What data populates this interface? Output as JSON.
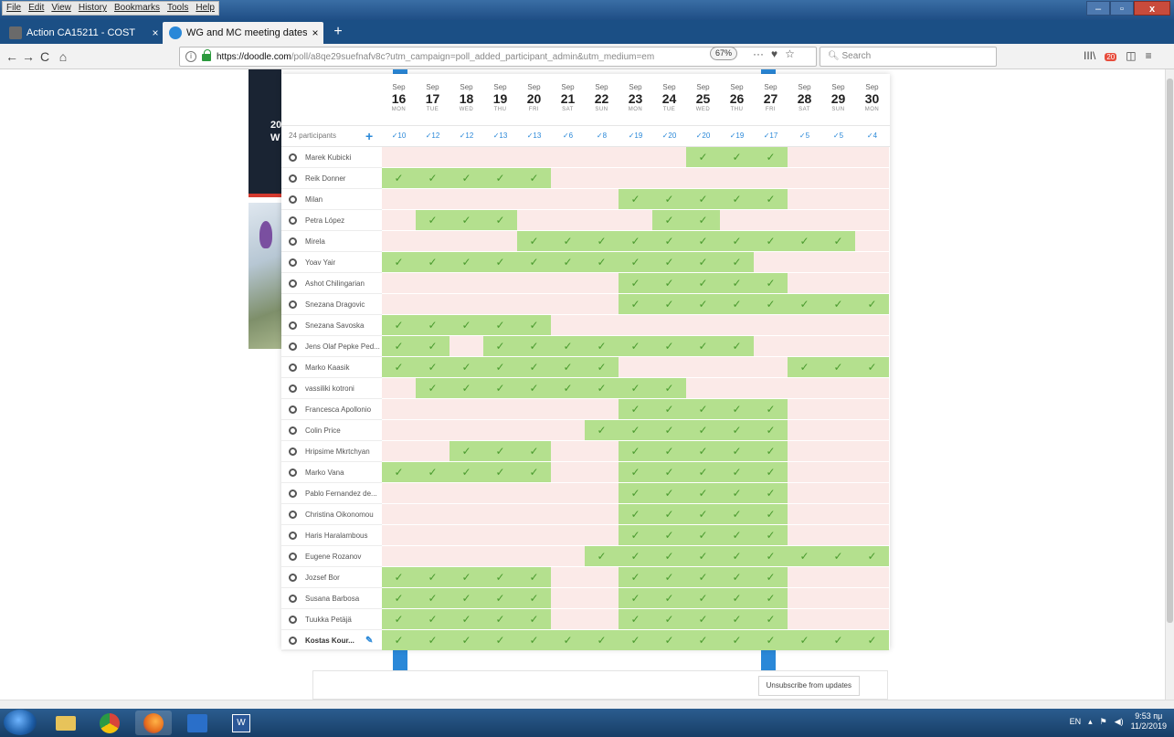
{
  "menu": [
    "File",
    "Edit",
    "View",
    "History",
    "Bookmarks",
    "Tools",
    "Help"
  ],
  "window_controls": {
    "minimize": "–",
    "maximize": "▫",
    "close": "x"
  },
  "tabs": [
    {
      "label": "Action CA15211 - COST",
      "close": "×"
    },
    {
      "label": "WG and MC meeting dates | D",
      "close": "×"
    }
  ],
  "new_tab": "+",
  "nav": {
    "back": "←",
    "forward": "→",
    "reload": "C",
    "home": "⌂",
    "url_host": "https://doodle.com",
    "url_path": "/poll/a8qe29suefnafv8c?utm_campaign=poll_added_participant_admin&utm_medium=em",
    "zoom": "67%",
    "more": "···",
    "pocket": "♥",
    "star": "☆",
    "search_placeholder": "Search",
    "library": "III\\",
    "badge": "20",
    "sidebar": "◫",
    "menu": "≡"
  },
  "hero_text": "20\nW",
  "poll": {
    "participants_label": "24 participants",
    "add_button": "+",
    "dates": [
      {
        "month": "Sep",
        "day": "16",
        "weekday": "MON"
      },
      {
        "month": "Sep",
        "day": "17",
        "weekday": "TUE"
      },
      {
        "month": "Sep",
        "day": "18",
        "weekday": "WED"
      },
      {
        "month": "Sep",
        "day": "19",
        "weekday": "THU"
      },
      {
        "month": "Sep",
        "day": "20",
        "weekday": "FRI"
      },
      {
        "month": "Sep",
        "day": "21",
        "weekday": "SAT"
      },
      {
        "month": "Sep",
        "day": "22",
        "weekday": "SUN"
      },
      {
        "month": "Sep",
        "day": "23",
        "weekday": "MON"
      },
      {
        "month": "Sep",
        "day": "24",
        "weekday": "TUE"
      },
      {
        "month": "Sep",
        "day": "25",
        "weekday": "WED"
      },
      {
        "month": "Sep",
        "day": "26",
        "weekday": "THU"
      },
      {
        "month": "Sep",
        "day": "27",
        "weekday": "FRI"
      },
      {
        "month": "Sep",
        "day": "28",
        "weekday": "SAT"
      },
      {
        "month": "Sep",
        "day": "29",
        "weekday": "SUN"
      },
      {
        "month": "Sep",
        "day": "30",
        "weekday": "MON"
      }
    ],
    "counts": [
      "✓10",
      "✓12",
      "✓12",
      "✓13",
      "✓13",
      "✓6",
      "✓8",
      "✓19",
      "✓20",
      "✓20",
      "✓19",
      "✓17",
      "✓5",
      "✓5",
      "✓4"
    ],
    "check_glyph": "✓",
    "participants": [
      {
        "name": "Marek Kubicki",
        "votes": "000000000111000"
      },
      {
        "name": "Reik Donner",
        "votes": "111110000000000"
      },
      {
        "name": "Milan",
        "votes": "000000011111000"
      },
      {
        "name": "Petra López",
        "votes": "011100001100000"
      },
      {
        "name": "Mirela",
        "votes": "000011111111110"
      },
      {
        "name": "Yoav Yair",
        "votes": "111111111110000"
      },
      {
        "name": "Ashot Chilingarian",
        "votes": "000000011111000"
      },
      {
        "name": "Snezana Dragovic",
        "votes": "000000011111111"
      },
      {
        "name": "Snezana Savoska",
        "votes": "111110000000000"
      },
      {
        "name": "Jens Olaf Pepke Ped...",
        "votes": "110111111110000"
      },
      {
        "name": "Marko Kaasik",
        "votes": "111111100000111"
      },
      {
        "name": "vassiliki kotroni",
        "votes": "011111111000000"
      },
      {
        "name": "Francesca Apollonio",
        "votes": "000000011111000"
      },
      {
        "name": "Colin Price",
        "votes": "000000111111000"
      },
      {
        "name": "Hripsime Mkrtchyan",
        "votes": "001110011111000"
      },
      {
        "name": "Marko Vana",
        "votes": "111110011111000"
      },
      {
        "name": "Pablo Fernandez de...",
        "votes": "000000011111000"
      },
      {
        "name": "Christina Oikonomou",
        "votes": "000000011111000"
      },
      {
        "name": "Haris Haralambous",
        "votes": "000000011111000"
      },
      {
        "name": "Eugene Rozanov",
        "votes": "000000111111111"
      },
      {
        "name": "Jozsef Bor",
        "votes": "111110011111000"
      },
      {
        "name": "Susana Barbosa",
        "votes": "111110011111000"
      },
      {
        "name": "Tuukka Petäjä",
        "votes": "111110011111000"
      },
      {
        "name": "Kostas Kour...",
        "votes": "111111111111111",
        "self": true,
        "edit": "✎"
      }
    ]
  },
  "unsubscribe": "Unsubscribe from updates",
  "taskbar": {
    "lang": "EN",
    "time": "9:53 пμ",
    "date": "11/2/2019"
  },
  "colors": {
    "yes": "#b4e08e",
    "no": "#fbeae8",
    "accent": "#2a88d8",
    "check": "#4a9a2e"
  }
}
